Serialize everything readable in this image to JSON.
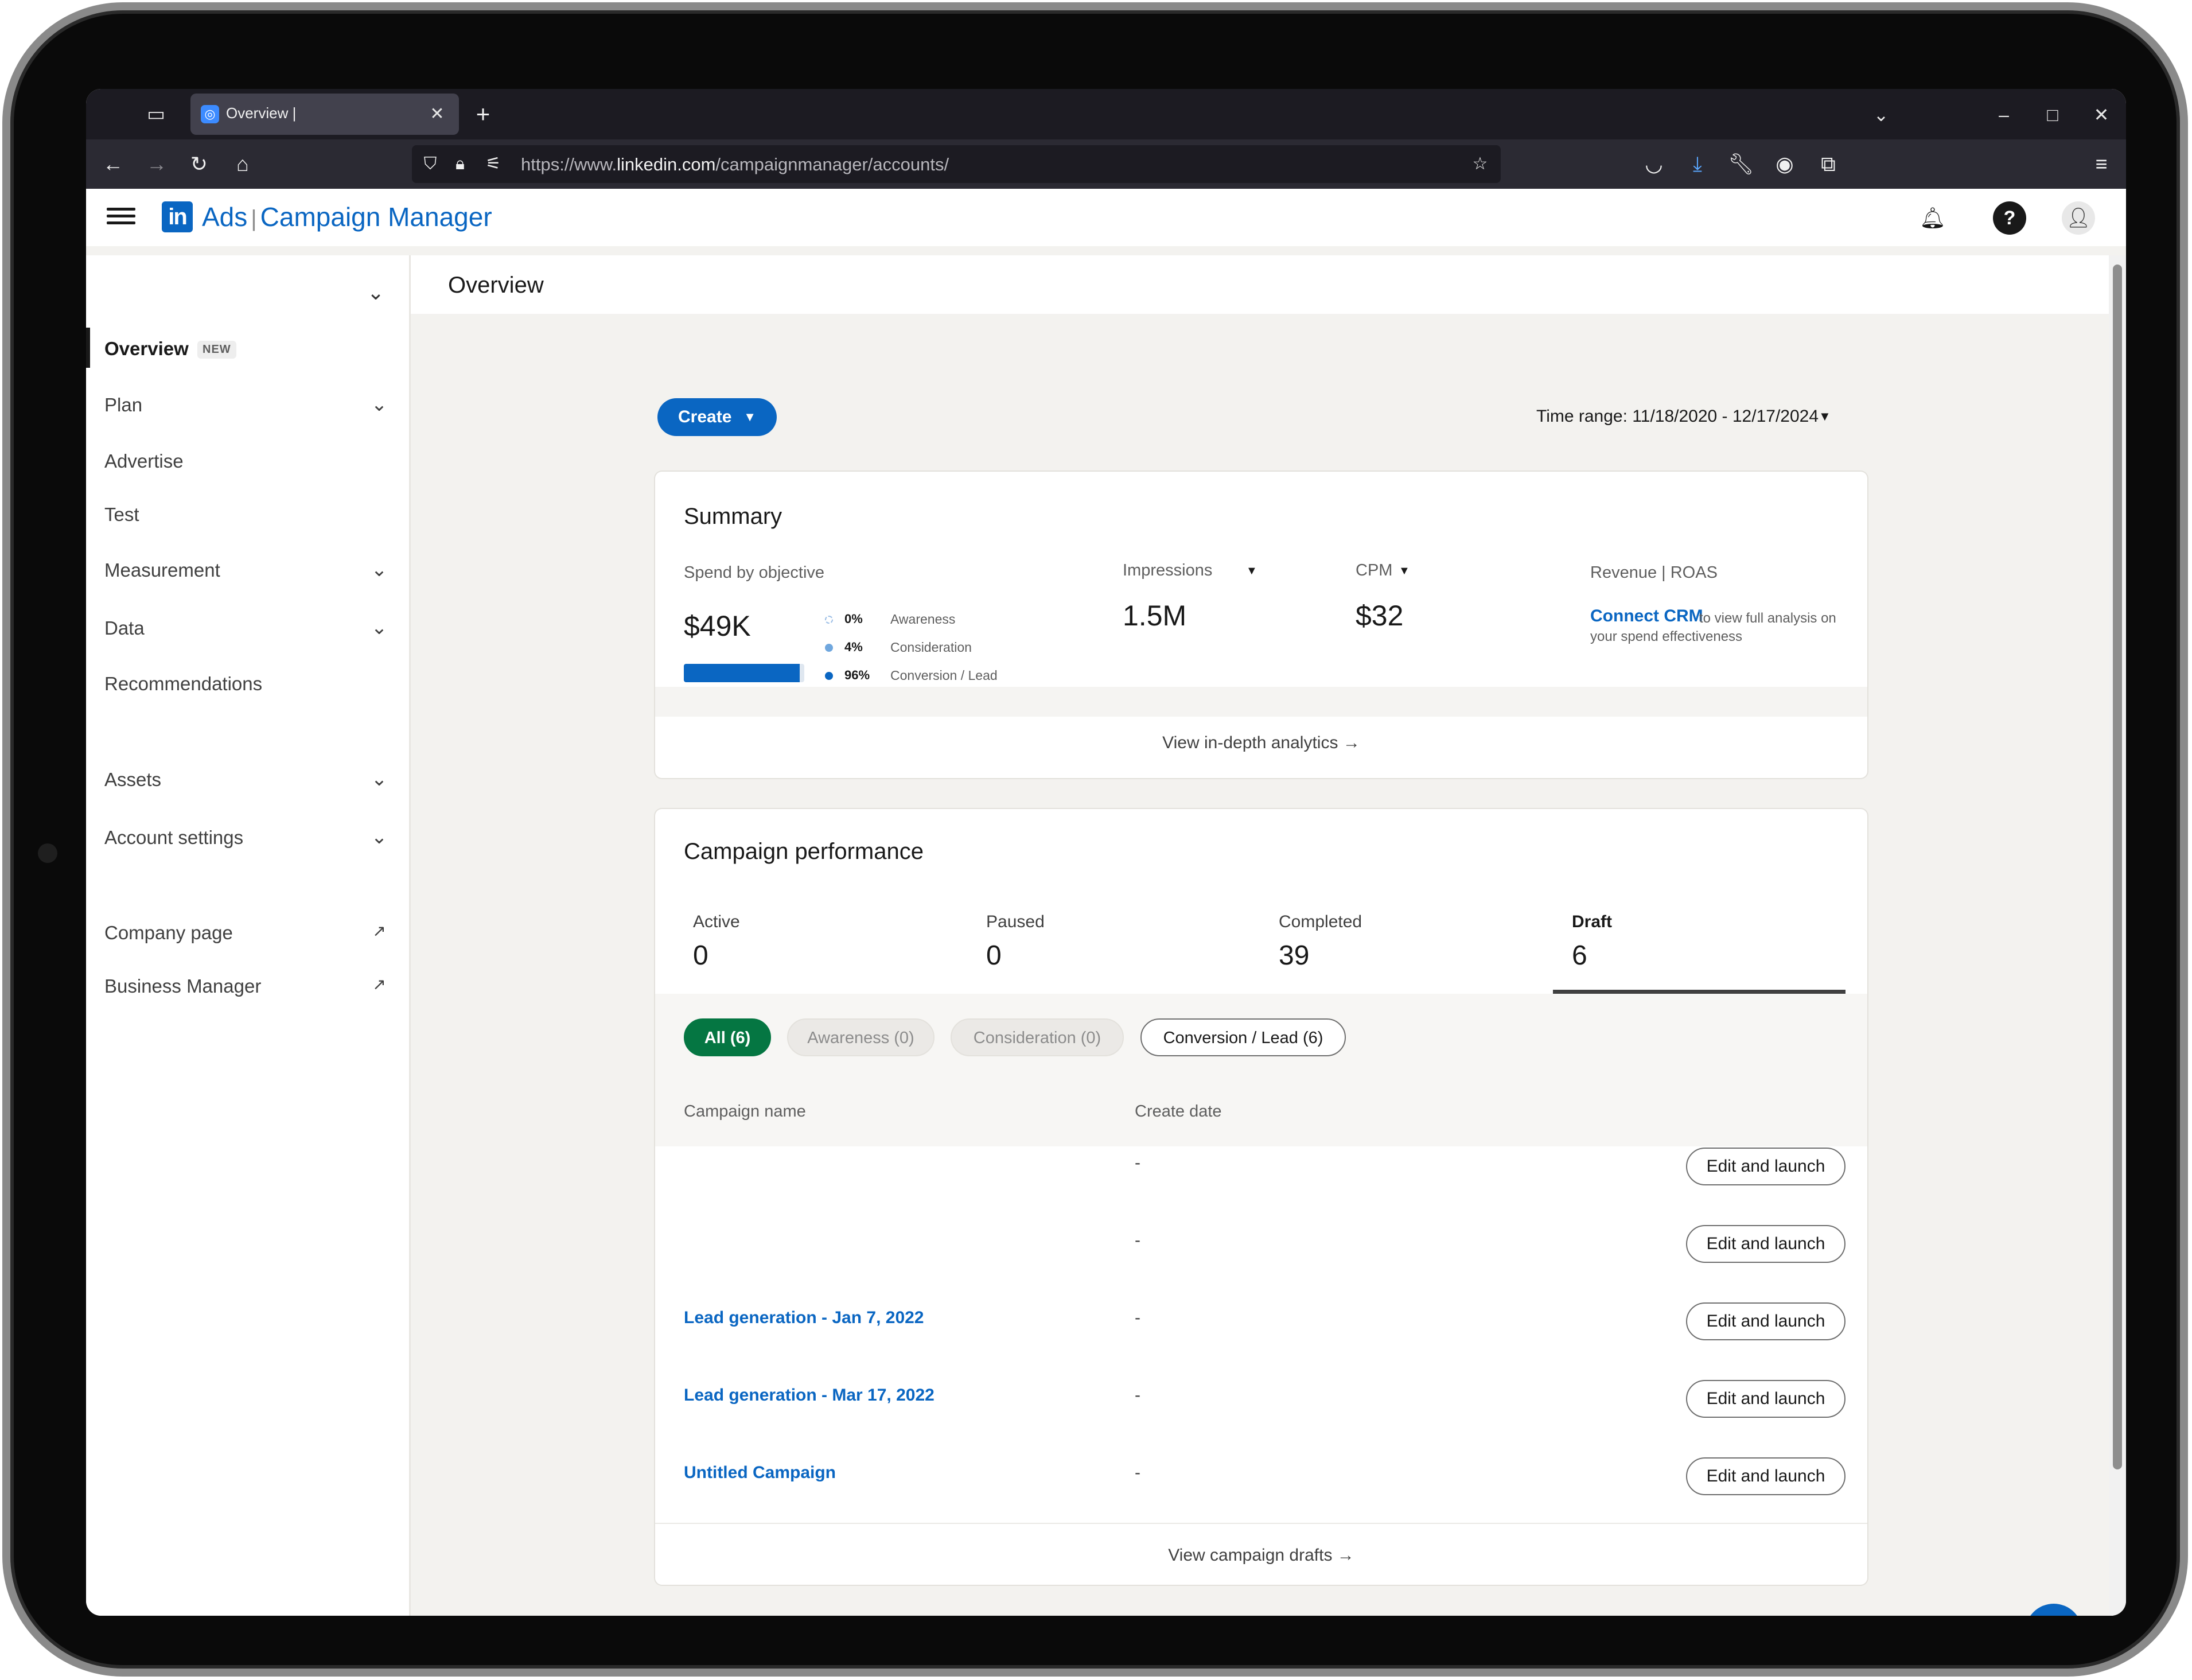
{
  "browser": {
    "tab_title": "Overview |",
    "url_prefix": "https://www.",
    "url_domain": "linkedin.com",
    "url_path": "/campaignmanager/accounts/"
  },
  "header": {
    "brand_ads": "Ads",
    "brand_sep": "|",
    "brand_product": "Campaign Manager"
  },
  "sidebar": {
    "items": [
      {
        "label": "Overview",
        "badge": "NEW"
      },
      {
        "label": "Plan"
      },
      {
        "label": "Advertise"
      },
      {
        "label": "Test"
      },
      {
        "label": "Measurement"
      },
      {
        "label": "Data"
      },
      {
        "label": "Recommendations"
      },
      {
        "label": "Assets"
      },
      {
        "label": "Account settings"
      },
      {
        "label": "Company page"
      },
      {
        "label": "Business Manager"
      }
    ]
  },
  "page": {
    "title": "Overview",
    "create_label": "Create",
    "time_range_label": "Time range:",
    "time_range_value": "11/18/2020 - 12/17/2024"
  },
  "summary": {
    "title": "Summary",
    "spend_label": "Spend by objective",
    "spend_value": "$49K",
    "spend_fill_fraction": 0.96,
    "objectives": [
      {
        "pct": "0%",
        "name": "Awareness",
        "color": "#d6e4f5"
      },
      {
        "pct": "4%",
        "name": "Consideration",
        "color": "#70a7de"
      },
      {
        "pct": "96%",
        "name": "Conversion / Lead",
        "color": "#0a66c2"
      }
    ],
    "impressions_label": "Impressions",
    "impressions_value": "1.5M",
    "cpm_label": "CPM",
    "cpm_value": "$32",
    "revenue_label": "Revenue | ROAS",
    "crm_link": "Connect CRM",
    "crm_text": "to view full analysis on your spend effectiveness",
    "footer_link": "View in-depth analytics"
  },
  "performance": {
    "title": "Campaign performance",
    "stats": [
      {
        "label": "Active",
        "value": "0"
      },
      {
        "label": "Paused",
        "value": "0"
      },
      {
        "label": "Completed",
        "value": "39"
      },
      {
        "label": "Draft",
        "value": "6"
      }
    ],
    "chips": [
      {
        "label": "All (6)"
      },
      {
        "label": "Awareness (0)"
      },
      {
        "label": "Consideration (0)"
      },
      {
        "label": "Conversion / Lead (6)"
      }
    ],
    "columns": {
      "name": "Campaign name",
      "date": "Create date"
    },
    "rows": [
      {
        "name": "",
        "date": "-",
        "action": "Edit and launch"
      },
      {
        "name": "",
        "date": "-",
        "action": "Edit and launch"
      },
      {
        "name": "Lead generation - Jan 7, 2022",
        "date": "-",
        "action": "Edit and launch"
      },
      {
        "name": "Lead generation - Mar 17, 2022",
        "date": "-",
        "action": "Edit and launch"
      },
      {
        "name": "Untitled Campaign",
        "date": "-",
        "action": "Edit and launch"
      }
    ],
    "footer_link": "View campaign drafts"
  },
  "icons": {
    "accent": "#0a66c2",
    "success": "#057642"
  }
}
